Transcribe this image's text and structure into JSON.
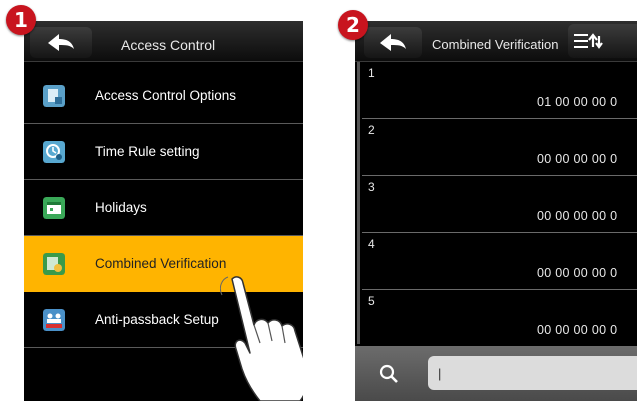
{
  "steps": {
    "first": "1",
    "second": "2"
  },
  "left_screen": {
    "title": "Access Control",
    "items": [
      {
        "label": "Access Control Options",
        "icon": "access-options-icon",
        "color": "#5aa0c8"
      },
      {
        "label": "Time Rule setting",
        "icon": "time-rule-icon",
        "color": "#58a8d0"
      },
      {
        "label": "Holidays",
        "icon": "holidays-calendar-icon",
        "color": "#3aa858"
      },
      {
        "label": "Combined Verification",
        "icon": "combined-verification-icon",
        "color": "#3a9a4a",
        "selected": true
      },
      {
        "label": "Anti-passback Setup",
        "icon": "anti-passback-icon",
        "color": "#4a90c8"
      }
    ]
  },
  "right_screen": {
    "title": "Combined Verification",
    "records": [
      {
        "number": "1",
        "value": "01 00 00 00 0"
      },
      {
        "number": "2",
        "value": "00 00 00 00 0"
      },
      {
        "number": "3",
        "value": "00 00 00 00 0"
      },
      {
        "number": "4",
        "value": "00 00 00 00 0"
      },
      {
        "number": "5",
        "value": "00 00 00 00 0"
      }
    ],
    "search": {
      "value": "|"
    }
  },
  "colors": {
    "selected_row": "#ffb400",
    "badge": "#c8141e",
    "screen_bg": "#000000"
  }
}
